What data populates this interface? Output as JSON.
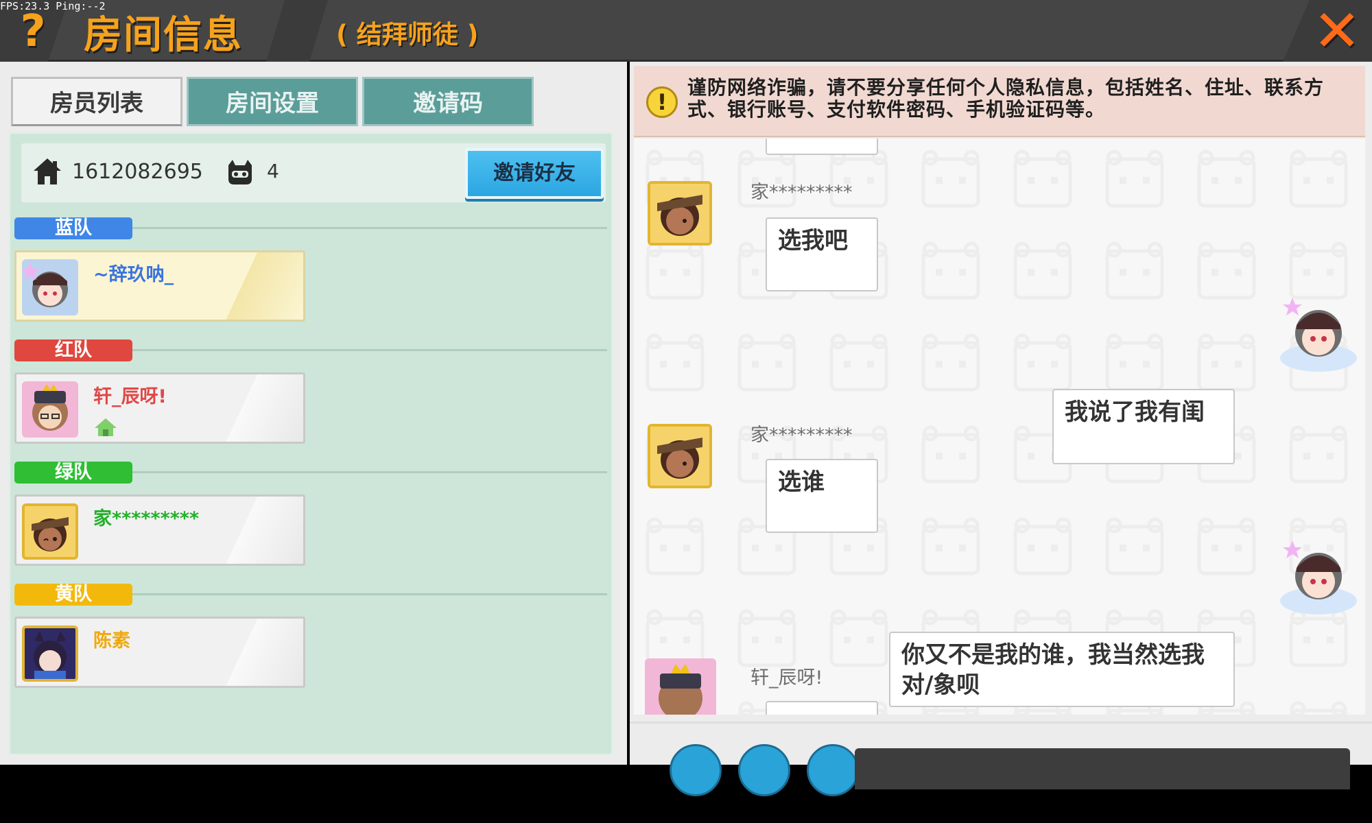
{
  "debug": {
    "fps_text": "FPS:23.3  Ping:--2"
  },
  "header": {
    "help_icon": "question-mark-icon",
    "help_glyph": "?",
    "title": "房间信息",
    "subtitle": "( 结拜师徒 )",
    "close_icon": "close-x-icon",
    "close_glyph": "✕",
    "accent_color": "#f6a21c"
  },
  "tabs": [
    {
      "label": "房员列表",
      "active": true
    },
    {
      "label": "房间设置",
      "active": false
    },
    {
      "label": "邀请码",
      "active": false
    }
  ],
  "room": {
    "home_icon": "home-icon",
    "room_id": "1612082695",
    "players_icon": "player-head-icon",
    "player_count": "4",
    "invite_button": "邀请好友"
  },
  "teams": [
    {
      "label": "蓝队",
      "color": "#3f86e6",
      "members": [
        {
          "name": "~辞玖呐_",
          "name_color": "#3a74e0",
          "is_me": true
        }
      ]
    },
    {
      "label": "红队",
      "color": "#e0473e",
      "members": [
        {
          "name": "轩_辰呀!",
          "name_color": "#e04848",
          "is_host": true
        }
      ]
    },
    {
      "label": "绿队",
      "color": "#2fbe34",
      "members": [
        {
          "name": "家*********",
          "name_color": "#21b02a"
        }
      ]
    },
    {
      "label": "黄队",
      "color": "#f2b90c",
      "members": [
        {
          "name": "陈素",
          "name_color": "#f0a90a"
        }
      ]
    }
  ],
  "warning": {
    "icon": "warning-exclamation-icon",
    "glyph": "!",
    "text": "谨防网络诈骗，请不要分享任何个人隐私信息，包括姓名、住址、联系方式、银行账号、支付软件密码、手机验证码等。"
  },
  "chat": {
    "messages": [
      {
        "sender": "家*********",
        "side": "left",
        "text": "选我吧"
      },
      {
        "sender": "",
        "side": "right",
        "text": "我说了我有闺"
      },
      {
        "sender": "家*********",
        "side": "left",
        "text": "选谁"
      },
      {
        "sender": "",
        "side": "right",
        "text": "你又不是我的谁，我当然选我对/象呗"
      },
      {
        "sender": "轩_辰呀!",
        "side": "left",
        "text": ""
      }
    ]
  }
}
